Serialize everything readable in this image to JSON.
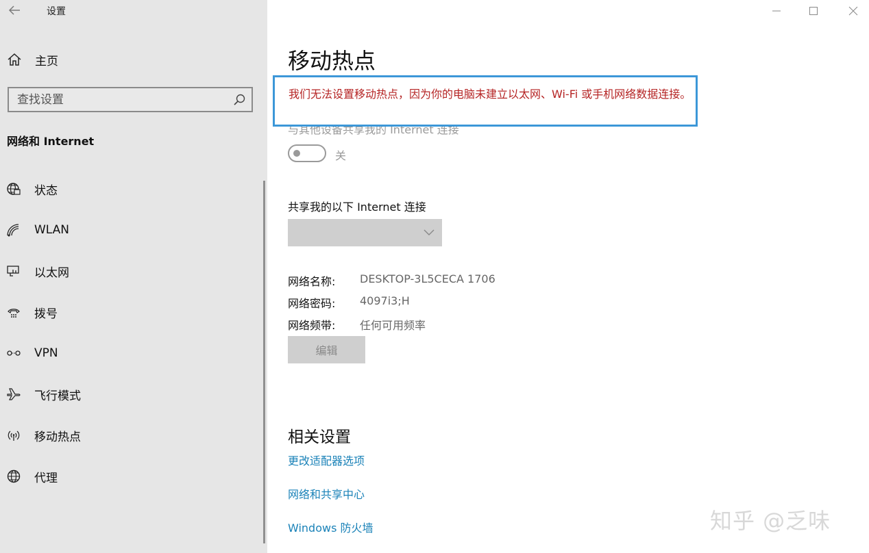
{
  "window": {
    "title": "设置"
  },
  "sidebar": {
    "home_label": "主页",
    "search_placeholder": "查找设置",
    "section_title": "网络和 Internet",
    "items": [
      {
        "label": "状态",
        "icon": "globe-status-icon"
      },
      {
        "label": "WLAN",
        "icon": "wifi-icon"
      },
      {
        "label": "以太网",
        "icon": "ethernet-icon"
      },
      {
        "label": "拨号",
        "icon": "dialup-icon"
      },
      {
        "label": "VPN",
        "icon": "vpn-icon"
      },
      {
        "label": "飞行模式",
        "icon": "airplane-icon"
      },
      {
        "label": "移动热点",
        "icon": "hotspot-icon"
      },
      {
        "label": "代理",
        "icon": "globe-proxy-icon"
      }
    ]
  },
  "main": {
    "title": "移动热点",
    "error_message": "我们无法设置移动热点，因为你的电脑未建立以太网、Wi-Fi 或手机网络数据连接。",
    "share_label": "与其他设备共享我的 Internet 连接",
    "toggle_state": "关",
    "toggle_on": false,
    "share_from_label": "共享我的以下 Internet 连接",
    "share_from_value": "",
    "network_info": [
      {
        "key": "网络名称:",
        "value": "DESKTOP-3L5CECA 1706"
      },
      {
        "key": "网络密码:",
        "value": "4097i3;H"
      },
      {
        "key": "网络频带:",
        "value": "任何可用频率"
      }
    ],
    "edit_button": "编辑",
    "related_title": "相关设置",
    "related_links": [
      "更改适配器选项",
      "网络和共享中心",
      "Windows 防火墙"
    ]
  },
  "watermark": "知乎 @乏味",
  "colors": {
    "sidebar_bg": "#e6e6e6",
    "error_text": "#b52424",
    "highlight_border": "#3c97d8",
    "link": "#1a82b8"
  }
}
